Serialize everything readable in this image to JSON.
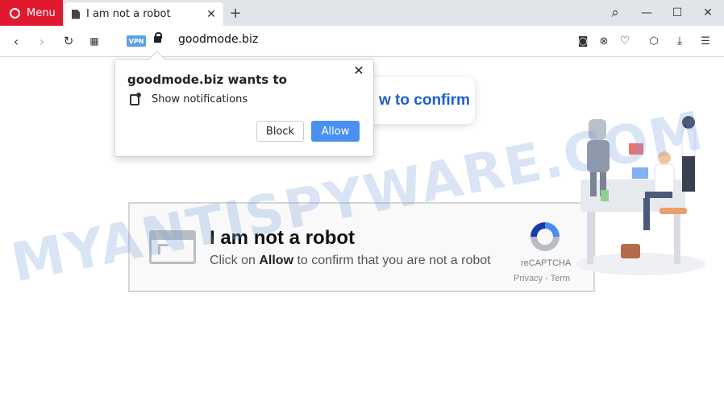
{
  "browser": {
    "menu_label": "Menu",
    "tab_title": "I am not a robot",
    "tab_close": "✕",
    "new_tab": "+",
    "url": "goodmode.biz",
    "vpn_badge": "VPN",
    "window": {
      "search": "⌕",
      "minimize": "—",
      "maximize": "☐",
      "close": "✕"
    },
    "colors": {
      "menu_red": "#e0192e",
      "tab_strip": "#e1e4e9"
    }
  },
  "popup": {
    "title": "goodmode.biz wants to",
    "permission": "Show notifications",
    "block_label": "Block",
    "allow_label": "Allow",
    "close_glyph": "✕"
  },
  "page": {
    "confirm_partial": "w to confirm",
    "captcha": {
      "title": "I am not a robot",
      "subtitle_pre": "Click on ",
      "subtitle_bold": "Allow",
      "subtitle_post": " to confirm that you are not a robot",
      "recaptcha_label": "reCAPTCHA",
      "links": "Privacy - Term"
    },
    "watermark": "MYANTISPYWARE.COM"
  }
}
